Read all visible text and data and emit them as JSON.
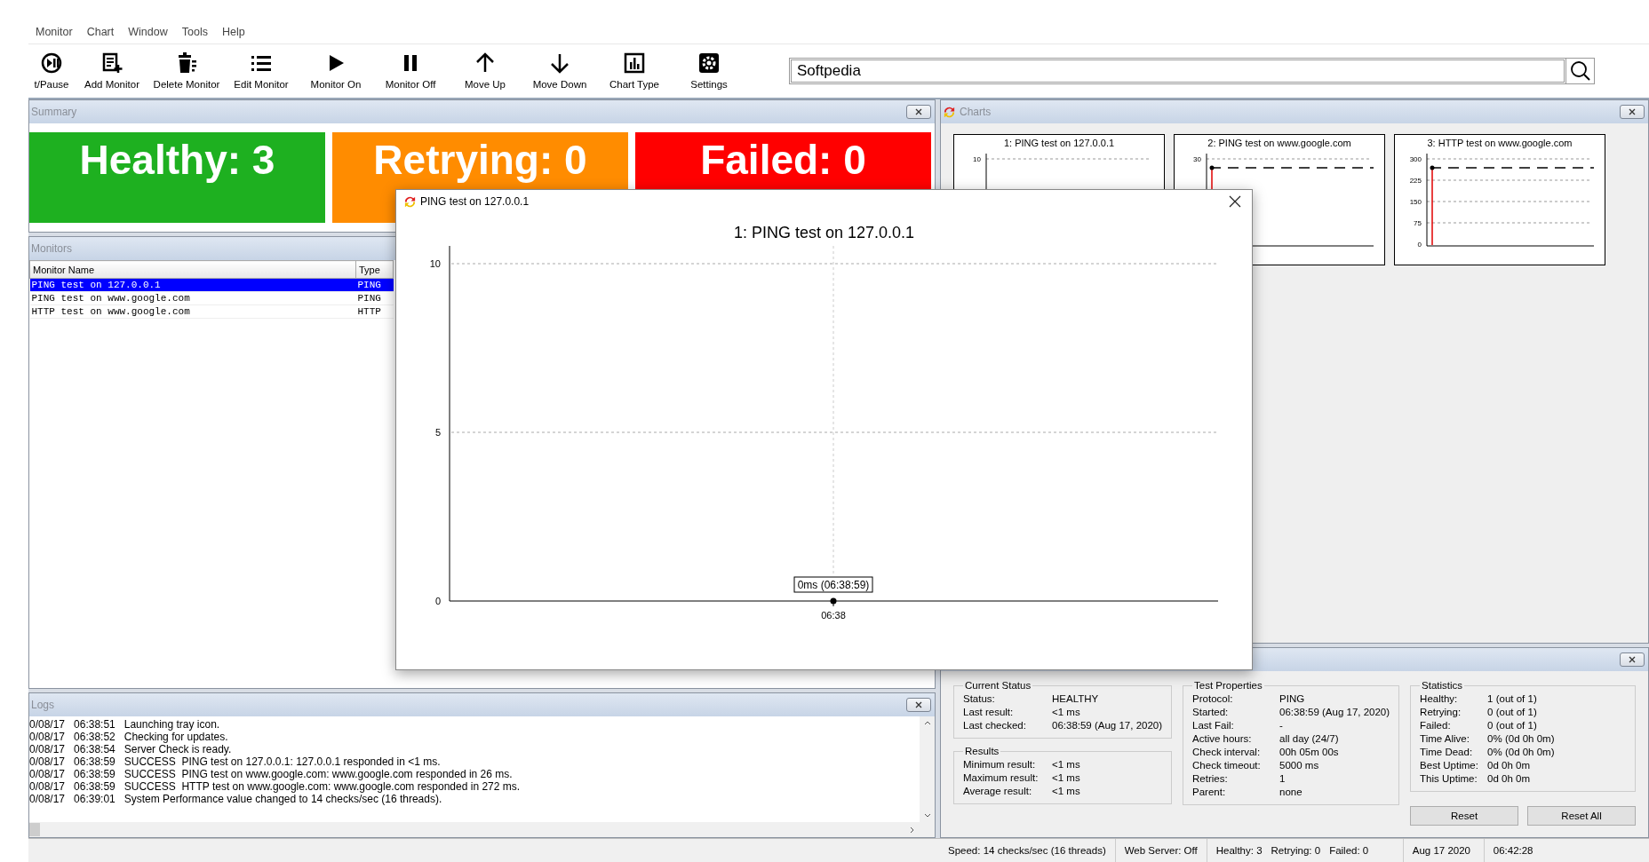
{
  "menu": [
    "Monitor",
    "Chart",
    "Window",
    "Tools",
    "Help"
  ],
  "toolbar": [
    "t/Pause",
    "Add Monitor",
    "Delete Monitor",
    "Edit Monitor",
    "Monitor On",
    "Monitor Off",
    "Move Up",
    "Move Down",
    "Chart Type",
    "Settings"
  ],
  "search": {
    "value": "Softpedia"
  },
  "summary": {
    "title": "Summary",
    "tiles": [
      {
        "label": "Healthy: 3",
        "color": "#1eb020"
      },
      {
        "label": "Retrying: 0",
        "color": "#ff8c00"
      },
      {
        "label": "Failed: 0",
        "color": "#ff0000"
      }
    ]
  },
  "monitors": {
    "title": "Monitors",
    "columns": [
      "Monitor Name",
      "Type"
    ],
    "rows": [
      {
        "name": "PING test on 127.0.0.1",
        "type": "PING",
        "selected": true
      },
      {
        "name": "PING test on www.google.com",
        "type": "PING",
        "selected": false
      },
      {
        "name": "HTTP test on www.google.com",
        "type": "HTTP",
        "selected": false
      }
    ]
  },
  "logs": {
    "title": "Logs",
    "lines": [
      {
        "date": "0/08/17",
        "time": "06:38:51",
        "message": "Launching tray icon."
      },
      {
        "date": "0/08/17",
        "time": "06:38:52",
        "message": "Checking for updates."
      },
      {
        "date": "0/08/17",
        "time": "06:38:54",
        "message": "Server Check is ready."
      },
      {
        "date": "0/08/17",
        "time": "06:38:59",
        "message": "SUCCESS  PING test on 127.0.0.1: 127.0.0.1 responded in <1 ms."
      },
      {
        "date": "0/08/17",
        "time": "06:38:59",
        "message": "SUCCESS  PING test on www.google.com: www.google.com responded in 26 ms."
      },
      {
        "date": "0/08/17",
        "time": "06:38:59",
        "message": "SUCCESS  HTTP test on www.google.com: www.google.com responded in 272 ms."
      },
      {
        "date": "0/08/17",
        "time": "06:39:01",
        "message": "System Performance value changed to 14 checks/sec (16 threads)."
      }
    ]
  },
  "charts": {
    "title": "Charts",
    "items": [
      {
        "title": "1: PING test on 127.0.0.1",
        "axis_labels": [
          "10"
        ],
        "marker": false
      },
      {
        "title": "2: PING test on www.google.com",
        "axis_labels": [
          "30"
        ],
        "marker": true
      },
      {
        "title": "3: HTTP test on www.google.com",
        "axis_labels": [
          "300",
          "225",
          "150",
          "75",
          "0"
        ],
        "marker": true
      }
    ]
  },
  "details": {
    "groups": [
      {
        "title": "Current Status",
        "fields": [
          {
            "label": "Status:",
            "value": "HEALTHY"
          },
          {
            "label": "Last result:",
            "value": "<1 ms"
          },
          {
            "label": "Last checked:",
            "value": "06:38:59 (Aug 17, 2020)"
          }
        ]
      },
      {
        "title": "Results",
        "fields": [
          {
            "label": "Minimum result:",
            "value": "<1 ms"
          },
          {
            "label": "Maximum result:",
            "value": "<1 ms"
          },
          {
            "label": "Average result:",
            "value": "<1 ms"
          }
        ]
      },
      {
        "title": "Test Properties",
        "fields": [
          {
            "label": "Protocol:",
            "value": "PING"
          },
          {
            "label": "Started:",
            "value": "06:38:59 (Aug 17, 2020)"
          },
          {
            "label": "Last Fail:",
            "value": "-"
          },
          {
            "label": "Active hours:",
            "value": "all day (24/7)"
          },
          {
            "label": "Check interval:",
            "value": "00h 05m 00s"
          },
          {
            "label": "Check timeout:",
            "value": "5000 ms"
          },
          {
            "label": "Retries:",
            "value": "1"
          },
          {
            "label": "Parent:",
            "value": "none"
          }
        ]
      },
      {
        "title": "Statistics",
        "fields": [
          {
            "label": "Healthy:",
            "value": "1 (out of 1)"
          },
          {
            "label": "Retrying:",
            "value": "0 (out of 1)"
          },
          {
            "label": "Failed:",
            "value": "0 (out of 1)"
          },
          {
            "label": "Time Alive:",
            "value": "0% (0d 0h 0m)"
          },
          {
            "label": "Time Dead:",
            "value": "0% (0d 0h 0m)"
          },
          {
            "label": "Best Uptime:",
            "value": "0d 0h 0m"
          },
          {
            "label": "This Uptime:",
            "value": "0d 0h 0m"
          }
        ]
      }
    ],
    "buttons": [
      "Reset",
      "Reset All"
    ]
  },
  "status_bar": {
    "speed": "Speed: 14 checks/sec (16 threads)",
    "web_server": "Web Server: Off",
    "counts": [
      "Healthy: 3",
      "Retrying: 0",
      "Failed: 0"
    ],
    "date": "Aug 17 2020",
    "time": "06:42:28"
  },
  "popup": {
    "title": "PING test on 127.0.0.1",
    "chart_title": "1: PING test on 127.0.0.1",
    "axis_labels": [
      "10",
      "5",
      "0"
    ],
    "time_label": "06:38",
    "value_label": "0ms (06:38:59)"
  }
}
